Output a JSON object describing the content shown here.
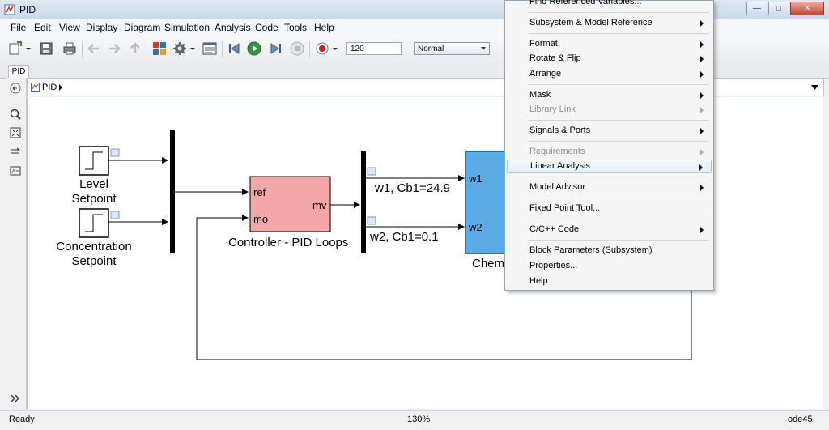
{
  "window": {
    "title": "PID"
  },
  "menubar": [
    "File",
    "Edit",
    "View",
    "Display",
    "Diagram",
    "Simulation",
    "Analysis",
    "Code",
    "Tools",
    "Help"
  ],
  "toolbar": {
    "stop_time": "120",
    "sim_mode": "Normal"
  },
  "tab": {
    "label": "PID"
  },
  "breadcrumb": {
    "model": "PID"
  },
  "diagram": {
    "level_setpoint": "Level\nSetpoint",
    "conc_setpoint": "Concentration\nSetpoint",
    "controller": {
      "label": "Controller - PID Loops",
      "port_ref": "ref",
      "port_mo": "mo",
      "port_mv": "mv"
    },
    "signal_w1": "w1, Cb1=24.9",
    "signal_w2": "w2, Cb1=0.1",
    "chem": {
      "label": "Chem",
      "port_w1": "w1",
      "port_w2": "w2"
    }
  },
  "context_menu": {
    "items": [
      {
        "label": "Find Referenced Variables...",
        "submenu": false,
        "disabled": false
      },
      {
        "label": "Subsystem & Model Reference",
        "submenu": true,
        "disabled": false
      },
      {
        "label": "Format",
        "submenu": true,
        "disabled": false
      },
      {
        "label": "Rotate & Flip",
        "submenu": true,
        "disabled": false
      },
      {
        "label": "Arrange",
        "submenu": true,
        "disabled": false
      },
      {
        "label": "Mask",
        "submenu": true,
        "disabled": false
      },
      {
        "label": "Library Link",
        "submenu": true,
        "disabled": true
      },
      {
        "label": "Signals & Ports",
        "submenu": true,
        "disabled": false
      },
      {
        "label": "Requirements",
        "submenu": true,
        "disabled": true
      },
      {
        "label": "Linear Analysis",
        "submenu": true,
        "disabled": false,
        "highlighted": true
      },
      {
        "label": "Model Advisor",
        "submenu": true,
        "disabled": false
      },
      {
        "label": "Fixed Point Tool...",
        "submenu": false,
        "disabled": false
      },
      {
        "label": "C/C++ Code",
        "submenu": true,
        "disabled": false
      },
      {
        "label": "Block Parameters (Subsystem)",
        "submenu": false,
        "disabled": false
      },
      {
        "label": "Properties...",
        "submenu": false,
        "disabled": false
      },
      {
        "label": "Help",
        "submenu": false,
        "disabled": false
      }
    ]
  },
  "statusbar": {
    "status": "Ready",
    "zoom": "130%",
    "solver": "ode45"
  },
  "colors": {
    "controller_fill": "#f4a7a9",
    "chem_fill": "#5aabe6",
    "menu_highlight": "#e4eef9"
  }
}
